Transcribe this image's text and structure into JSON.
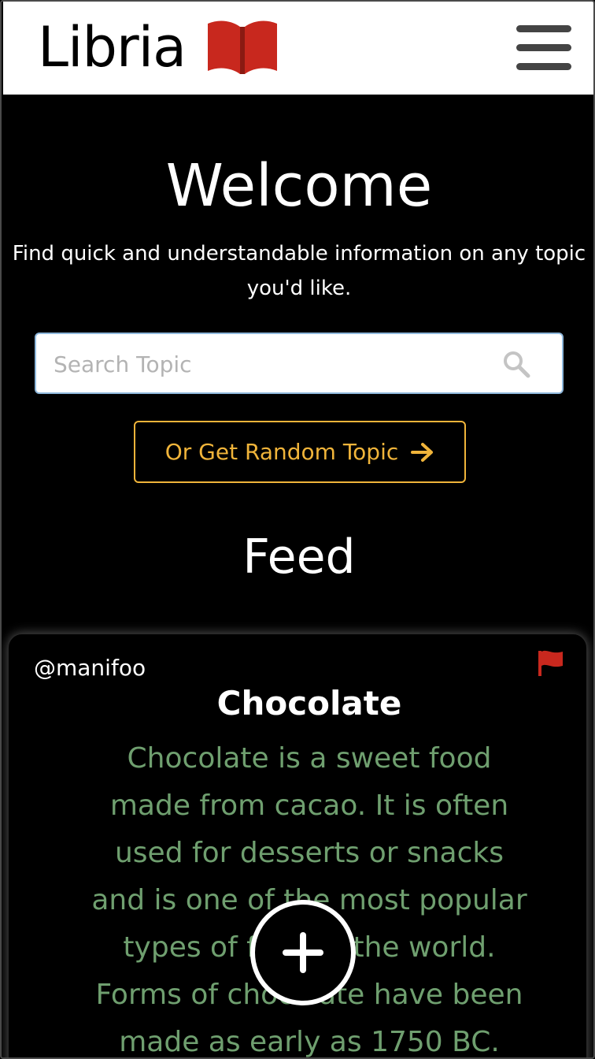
{
  "header": {
    "brand_name": "Libria",
    "logo_icon": "open-book-icon",
    "logo_color": "#c8281e",
    "menu_icon": "hamburger-menu-icon"
  },
  "hero": {
    "title": "Welcome",
    "tagline": "Find quick and understandable information on any topic you'd like."
  },
  "search": {
    "placeholder": "Search Topic",
    "value": "",
    "icon": "search-icon"
  },
  "random_button": {
    "label": "Or Get Random Topic",
    "icon": "arrow-right-icon",
    "color": "#f0b43a"
  },
  "feed": {
    "title": "Feed",
    "posts": [
      {
        "author": "@manifoo",
        "title": "Chocolate",
        "body": "Chocolate is a sweet food made from cacao. It is often used for desserts or snacks and is one of the most popular types of food in the world. Forms of chocolate have been made as early as 1750 BC.",
        "flag_icon": "flag-icon",
        "flag_color": "#c8281e",
        "body_color": "#6f9f6f"
      }
    ]
  },
  "fab": {
    "icon": "plus-icon"
  }
}
